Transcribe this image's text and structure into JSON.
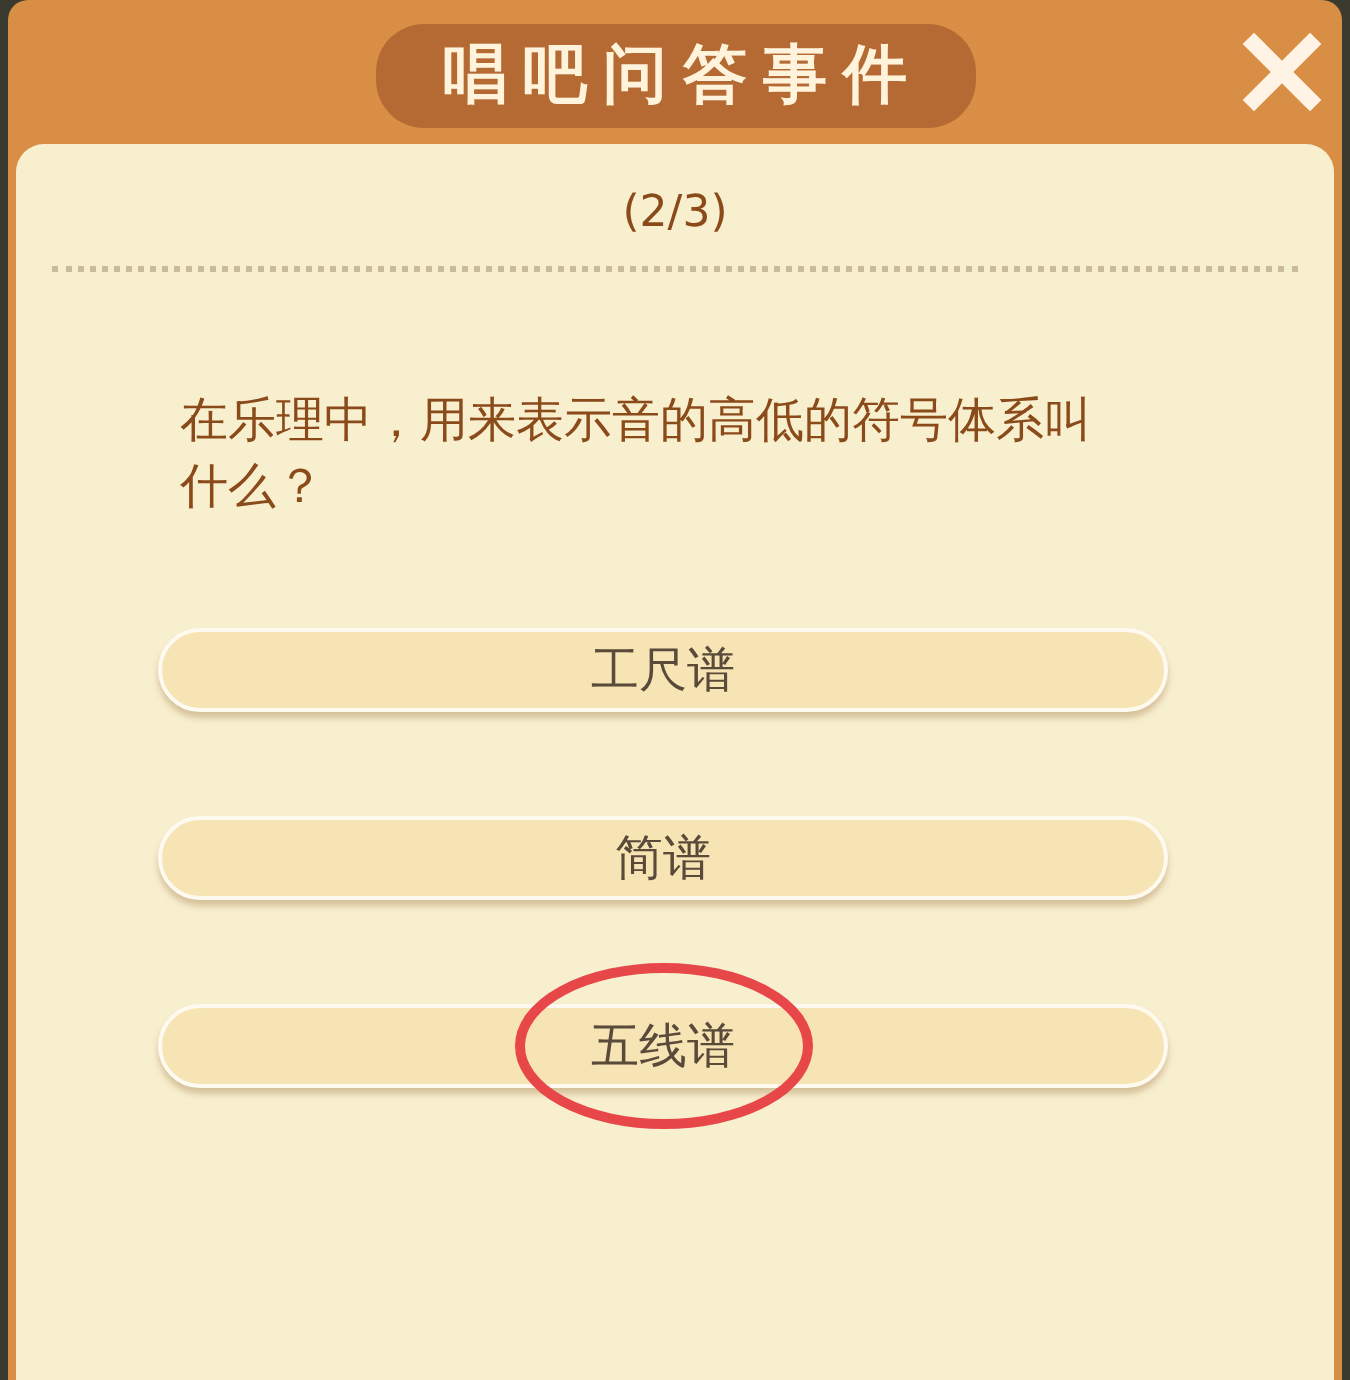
{
  "dialog": {
    "title": "唱吧问答事件"
  },
  "progress": "(2/3)",
  "question": "在乐理中，用来表示音的高低的符号体系叫什么？",
  "options": [
    {
      "label": "工尺谱",
      "circled": false
    },
    {
      "label": "简谱",
      "circled": false
    },
    {
      "label": "五线谱",
      "circled": true
    }
  ]
}
